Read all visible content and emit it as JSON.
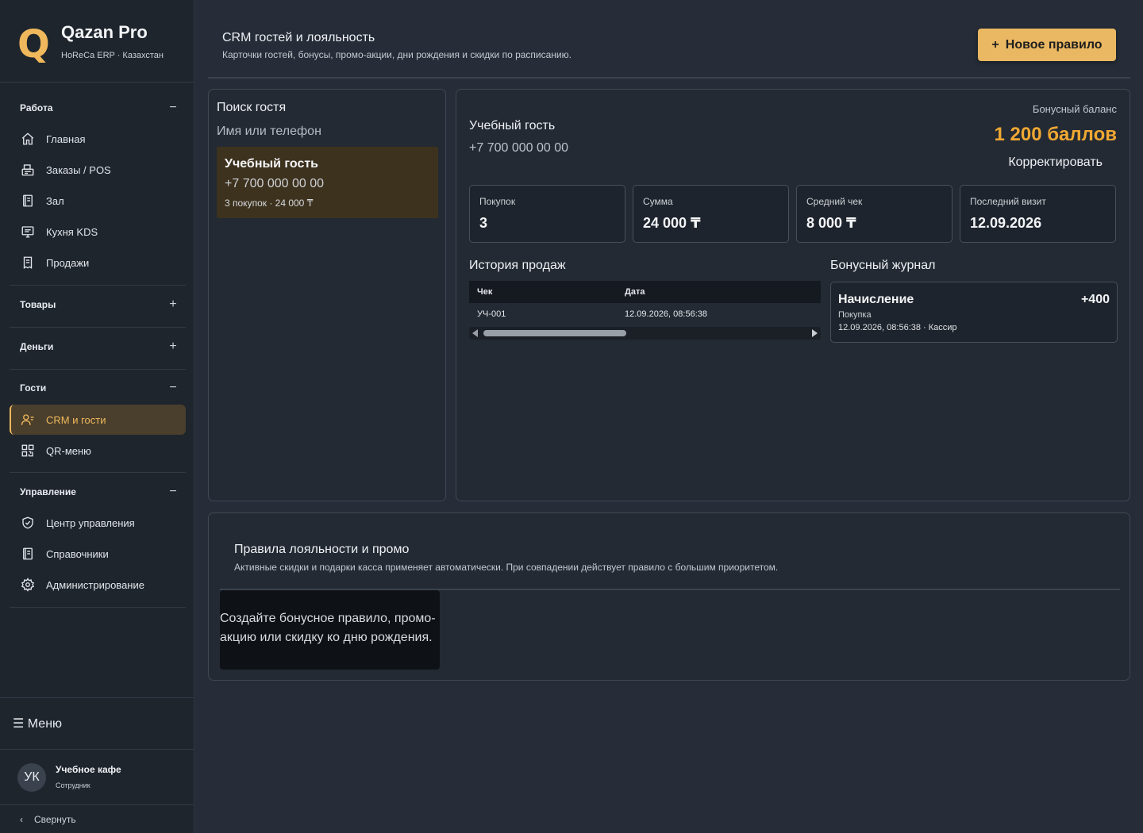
{
  "brand": {
    "logo": "Q",
    "title": "Qazan Pro",
    "subtitle": "HoReCa ERP · Казахстан"
  },
  "sidebar": {
    "groups": [
      {
        "label": "Работа",
        "toggle": "−"
      },
      {
        "label": "Товары",
        "toggle": "+"
      },
      {
        "label": "Деньги",
        "toggle": "+"
      },
      {
        "label": "Гости",
        "toggle": "−"
      },
      {
        "label": "Управление",
        "toggle": "−"
      }
    ],
    "items": {
      "home": "Главная",
      "orders": "Заказы / POS",
      "hall": "Зал",
      "kitchen": "Кухня KDS",
      "sales": "Продажи",
      "crm": "CRM и гости",
      "qr": "QR-меню",
      "control": "Центр управления",
      "refs": "Справочники",
      "admin": "Администрирование"
    },
    "menu_label": "☰ Меню",
    "user": {
      "initials": "УК",
      "name": "Учебное кафе",
      "role": "Сотрудник"
    },
    "collapse_label": "Свернуть",
    "collapse_icon": "‹"
  },
  "header": {
    "title": "CRM гостей и лояльность",
    "subtitle": "Карточки гостей, бонусы, промо-акции, дни рождения и скидки по расписанию.",
    "new_rule_icon": "+",
    "new_rule_label": "Новое правило"
  },
  "search": {
    "title": "Поиск гостя",
    "placeholder": "Имя или телефон",
    "result": {
      "name": "Учебный гость",
      "phone": "+7 700 000 00 00",
      "meta": "3 покупок · 24 000 ₸"
    }
  },
  "guest": {
    "name": "Учебный гость",
    "phone": "+7 700 000 00 00",
    "balance_label": "Бонусный баланс",
    "balance_value": "1 200 баллов",
    "adjust_label": "Корректировать",
    "stats": [
      {
        "label": "Покупок",
        "value": "3"
      },
      {
        "label": "Сумма",
        "value": "24 000 ₸"
      },
      {
        "label": "Средний чек",
        "value": "8 000 ₸"
      },
      {
        "label": "Последний визит",
        "value": "12.09.2026"
      }
    ],
    "history": {
      "title": "История продаж",
      "columns": [
        "Чек",
        "Дата"
      ],
      "rows": [
        {
          "check": "УЧ-001",
          "date": "12.09.2026, 08:56:38"
        }
      ]
    },
    "journal": {
      "title": "Бонусный журнал",
      "entries": [
        {
          "title": "Начисление",
          "amount": "+400",
          "type": "Покупка",
          "meta": "12.09.2026, 08:56:38 · Кассир"
        }
      ]
    }
  },
  "rules": {
    "title": "Правила лояльности и промо",
    "subtitle": "Активные скидки и подарки касса применяет автоматически. При совпадении действует правило с большим приоритетом.",
    "empty": "Создайте бонусное правило, промо-акцию или скидку ко дню рождения."
  },
  "colors": {
    "accent": "#f0b85c",
    "button": "#eab862",
    "balance": "#f0a832",
    "bg": "#262d38",
    "sidebar": "#1e252d"
  }
}
